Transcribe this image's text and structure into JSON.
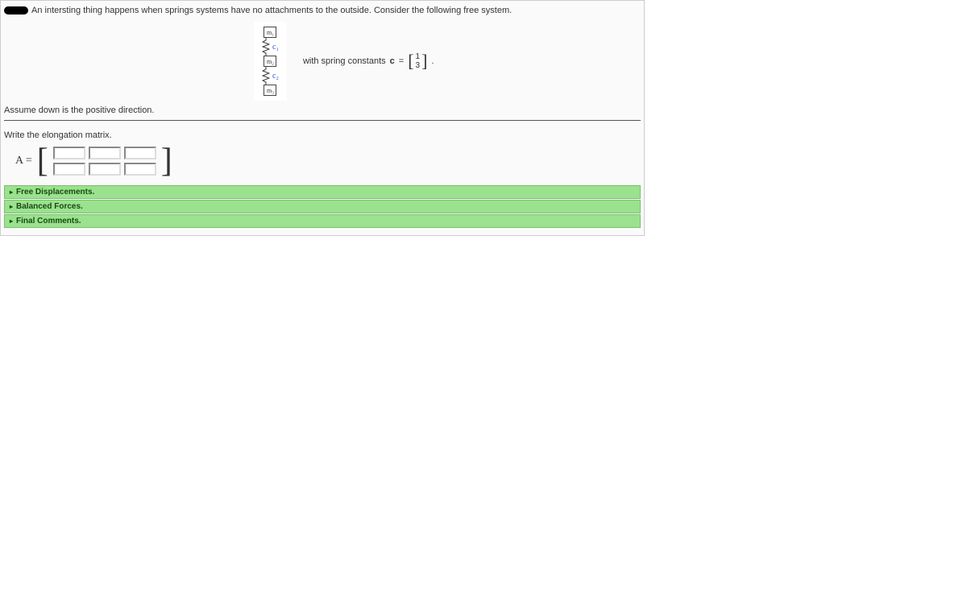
{
  "intro": "An intersting thing happens when springs systems have no attachments to the outside. Consider the following free system.",
  "diagram": {
    "mass_labels": [
      "m₁",
      "m₂",
      "m₃"
    ],
    "spring_labels": [
      "c₁",
      "c₂"
    ]
  },
  "figure_text_prefix": "with spring constants",
  "figure_text_bold": "c",
  "figure_text_eq": "=",
  "c_vector": [
    "1",
    "3"
  ],
  "figure_text_suffix": ".",
  "assumption": "Assume down is the positive direction.",
  "prompt_matrix": "Write the elongation matrix.",
  "matrix_label": "A =",
  "accordion": [
    "Free Displacements.",
    "Balanced Forces.",
    "Final Comments."
  ]
}
